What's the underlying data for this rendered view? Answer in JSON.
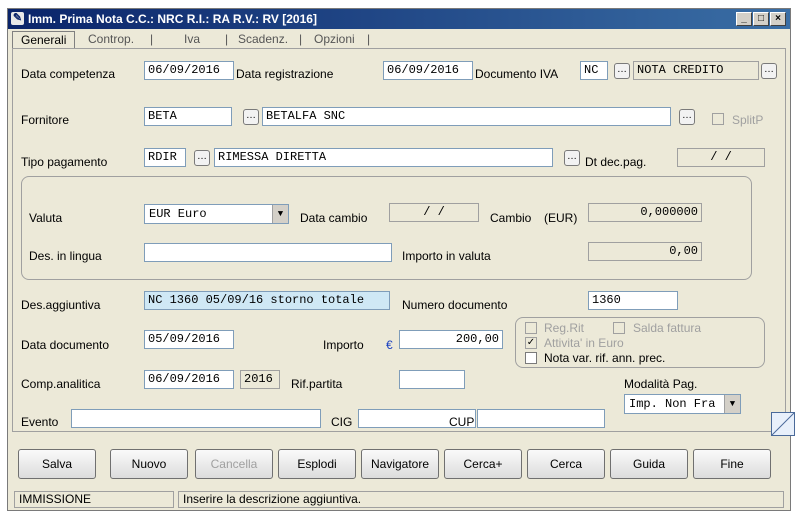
{
  "window": {
    "title": "Imm. Prima Nota C.C.: NRC  R.I.: RA  R.V.: RV  [2016]"
  },
  "tabs": [
    "Generali",
    "Controp.",
    "Iva",
    "Scadenz.",
    "Opzioni"
  ],
  "labels": {
    "data_competenza": "Data competenza",
    "data_registrazione": "Data registrazione",
    "documento_iva": "Documento IVA",
    "fornitore": "Fornitore",
    "splitp": "SplitP",
    "tipo_pagamento": "Tipo pagamento",
    "dt_dec_pag": "Dt dec.pag.",
    "valuta": "Valuta",
    "data_cambio": "Data cambio",
    "cambio": "Cambio",
    "cambio_unit": "(EUR)",
    "des_lingua": "Des. in lingua",
    "importo_valuta": "Importo in valuta",
    "des_aggiuntiva": "Des.aggiuntiva",
    "numero_documento": "Numero documento",
    "data_documento": "Data documento",
    "importo": "Importo",
    "reg_rit": "Reg.Rit",
    "salda_fattura": "Salda fattura",
    "attivita_euro": "Attivita' in Euro",
    "nota_var": "Nota var. rif. ann. prec.",
    "comp_analitica": "Comp.analitica",
    "rif_partita": "Rif.partita",
    "modalita_pag": "Modalità Pag.",
    "evento": "Evento",
    "cig": "CIG",
    "cup": "CUP"
  },
  "fields": {
    "data_competenza": "06/09/2016",
    "data_registrazione": "06/09/2016",
    "documento_iva_code": "NC",
    "documento_iva_desc": "NOTA CREDITO",
    "fornitore_code": "BETA",
    "fornitore_desc": "BETALFA SNC",
    "tipo_pagamento_code": "RDIR",
    "tipo_pagamento_desc": "RIMESSA DIRETTA",
    "dt_dec_pag": "/ /",
    "valuta": "EUR Euro",
    "data_cambio": "/ /",
    "cambio": "0,000000",
    "des_lingua": "",
    "importo_valuta": "0,00",
    "des_aggiuntiva": "NC 1360 05/09/16 storno totale",
    "numero_documento": "1360",
    "data_documento": "05/09/2016",
    "importo_currency": "€",
    "importo": "200,00",
    "comp_analitica_date": "06/09/2016",
    "comp_analitica_year": "2016",
    "rif_partita": "",
    "modalita_pag": "Imp. Non Fra",
    "evento": "",
    "cig": "",
    "cup": ""
  },
  "checkboxes": {
    "splitp": false,
    "reg_rit": false,
    "salda_fattura": false,
    "attivita_euro": true,
    "nota_var": false
  },
  "buttons": {
    "salva": "Salva",
    "nuovo": "Nuovo",
    "cancella": "Cancella",
    "esplodi": "Esplodi",
    "navigatore": "Navigatore",
    "cerca_plus": "Cerca+",
    "cerca": "Cerca",
    "guida": "Guida",
    "fine": "Fine"
  },
  "status": {
    "mode": "IMMISSIONE",
    "message": "Inserire la descrizione aggiuntiva."
  },
  "colors": {
    "title_bar": "#0a246a",
    "highlight_field": "#cfe8f5",
    "euro_sign": "#1a40c0"
  }
}
